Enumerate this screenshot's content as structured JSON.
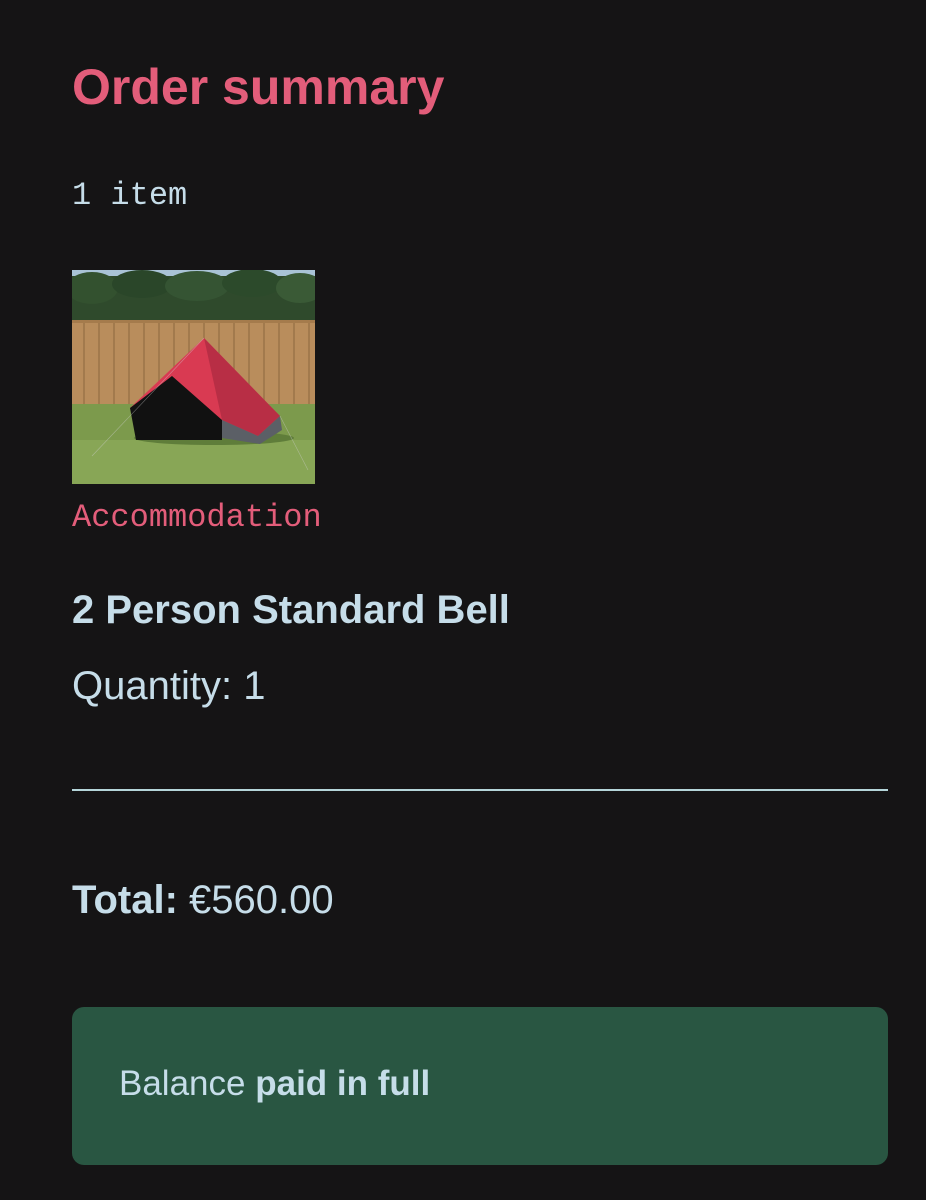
{
  "order_summary": {
    "title": "Order summary",
    "item_count": "1 item",
    "item": {
      "category": "Accommodation",
      "name": "2 Person Standard Bell",
      "quantity": "Quantity: 1"
    },
    "total": {
      "label": "Total:",
      "value": "€560.00"
    },
    "status": {
      "prefix": "Balance",
      "emphasis": "paid in full"
    }
  },
  "colors": {
    "background": "#151415",
    "accent_pink": "#e35d7a",
    "text_light_blue": "#c6dde9",
    "status_green": "#295642",
    "tent_red": "#d93a52"
  }
}
